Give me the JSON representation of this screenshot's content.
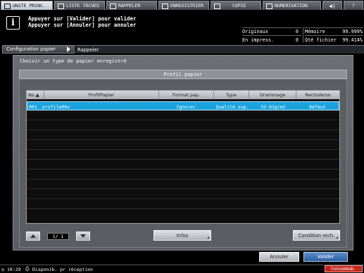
{
  "tabs": [
    {
      "label": "UNITE PRINC.",
      "icon": "home-icon",
      "active": true
    },
    {
      "label": "LISTE TÂCHES",
      "icon": "list-icon",
      "active": false
    },
    {
      "label": "RAPPELER",
      "icon": "recall-icon",
      "active": false
    },
    {
      "label": "ENREGISTRIER",
      "icon": "save-icon",
      "active": false
    },
    {
      "label": "COPIE",
      "icon": "copy-icon",
      "active": false
    },
    {
      "label": "NUMERISATION",
      "icon": "scan-icon",
      "active": false
    },
    {
      "label": "",
      "icon": "volume-icon",
      "active": false
    },
    {
      "label": "?",
      "icon": "help-icon",
      "active": false
    }
  ],
  "message": {
    "icon": "info-icon",
    "line1": "Appuyer sur [Valider] pour valider",
    "line2": "Appuyer sur [Annuler] pour annuler"
  },
  "counters": {
    "originaux_label": "Originaux",
    "originaux_value": "0",
    "impress_label": "En impress.",
    "impress_value": "0",
    "memoire_label": "Mémoire",
    "memoire_value": "99.999%",
    "qte_label": "Qté fichier",
    "qte_value": "99.414%"
  },
  "breadcrumb": {
    "parent": "Configuration papier",
    "current": "Rappeler"
  },
  "dialog": {
    "subtitle": "Choisir un type de papier enregistré",
    "header": "Profil papier"
  },
  "table": {
    "columns": {
      "no": "No.▲",
      "profil": "ProfilPapier",
      "format": "Format pap.",
      "type": "Type",
      "grammage": "Grammage",
      "recto": "RectoVerso"
    },
    "rows": [
      {
        "no": "001",
        "profil": "profile00x",
        "format": "Ignorer",
        "type": "Qualité sup.",
        "grammage": "52-61g/m2",
        "recto": "Défaut",
        "selected": true
      }
    ]
  },
  "pager": {
    "text": "1/  1"
  },
  "buttons": {
    "infos": "Infos",
    "condition": "Condition rech.",
    "annuler": "Annuler",
    "valider": "Valider"
  },
  "status": {
    "time": "10:29",
    "text": "Disponib. pr réception",
    "consumables": "Consommab."
  },
  "colors": {
    "selected_row": "#1aa3dd",
    "panel": "#5f6267",
    "ok_button": "#3f72b8",
    "consumables_alert": "#c3261d"
  }
}
